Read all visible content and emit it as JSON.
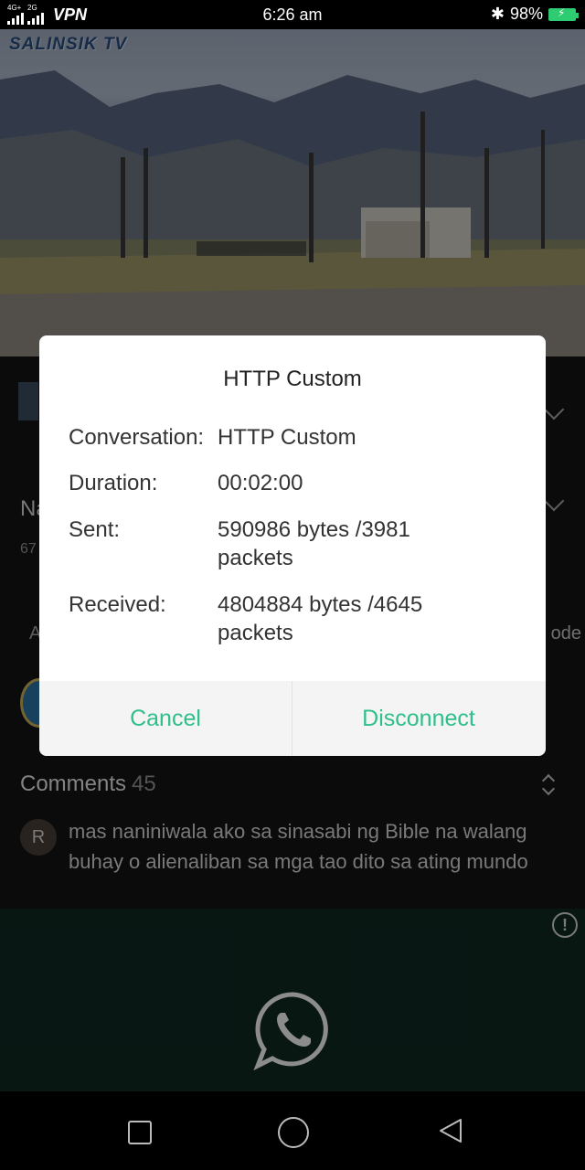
{
  "status_bar": {
    "network_1": "4G+",
    "network_2": "2G",
    "vpn": "VPN",
    "time": "6:26 am",
    "battery": "98%"
  },
  "video": {
    "watermark": "SALINSIK TV"
  },
  "background": {
    "title_partial": "Na",
    "views_partial": "67",
    "action_partial": "A",
    "mode_partial": "ode",
    "comments_label": "Comments",
    "comments_count": "45",
    "comment_avatar_letter": "R",
    "comment_text": "mas naniniwala ako sa sinasabi ng Bible na walang buhay o alienaliban sa mga tao dito sa ating mundo"
  },
  "ad": {
    "info_glyph": "!",
    "icon": "whatsapp-icon"
  },
  "dialog": {
    "title": "HTTP Custom",
    "rows": [
      {
        "label": "Conversation:",
        "value": "HTTP Custom"
      },
      {
        "label": "Duration:",
        "value": "00:02:00"
      },
      {
        "label": "Sent:",
        "value": "590986 bytes /3981 packets"
      },
      {
        "label": "Received:",
        "value": "4804884 bytes /4645 packets"
      }
    ],
    "cancel_label": "Cancel",
    "disconnect_label": "Disconnect",
    "accent_color": "#2fbf8a"
  }
}
